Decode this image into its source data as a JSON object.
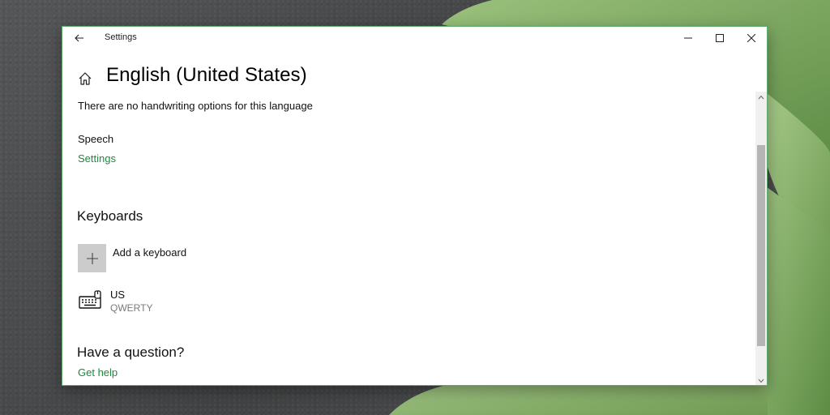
{
  "window": {
    "app_title": "Settings",
    "page_title": "English (United States)"
  },
  "icons": {
    "back": "back-arrow-icon",
    "home": "home-icon",
    "minimize": "minimize-icon",
    "maximize": "maximize-icon",
    "close": "close-icon",
    "plus": "plus-icon",
    "keyboard": "keyboard-icon"
  },
  "handwriting": {
    "note": "There are no handwriting options for this language"
  },
  "speech": {
    "label": "Speech",
    "settings_link": "Settings"
  },
  "keyboards": {
    "heading": "Keyboards",
    "add_label": "Add a keyboard",
    "items": [
      {
        "name": "US",
        "layout": "QWERTY"
      }
    ]
  },
  "help": {
    "heading": "Have a question?",
    "link": "Get help"
  },
  "colors": {
    "accent_link": "#1b8a3a",
    "window_border": "#5fa86a",
    "plus_tile": "#cccccc"
  }
}
